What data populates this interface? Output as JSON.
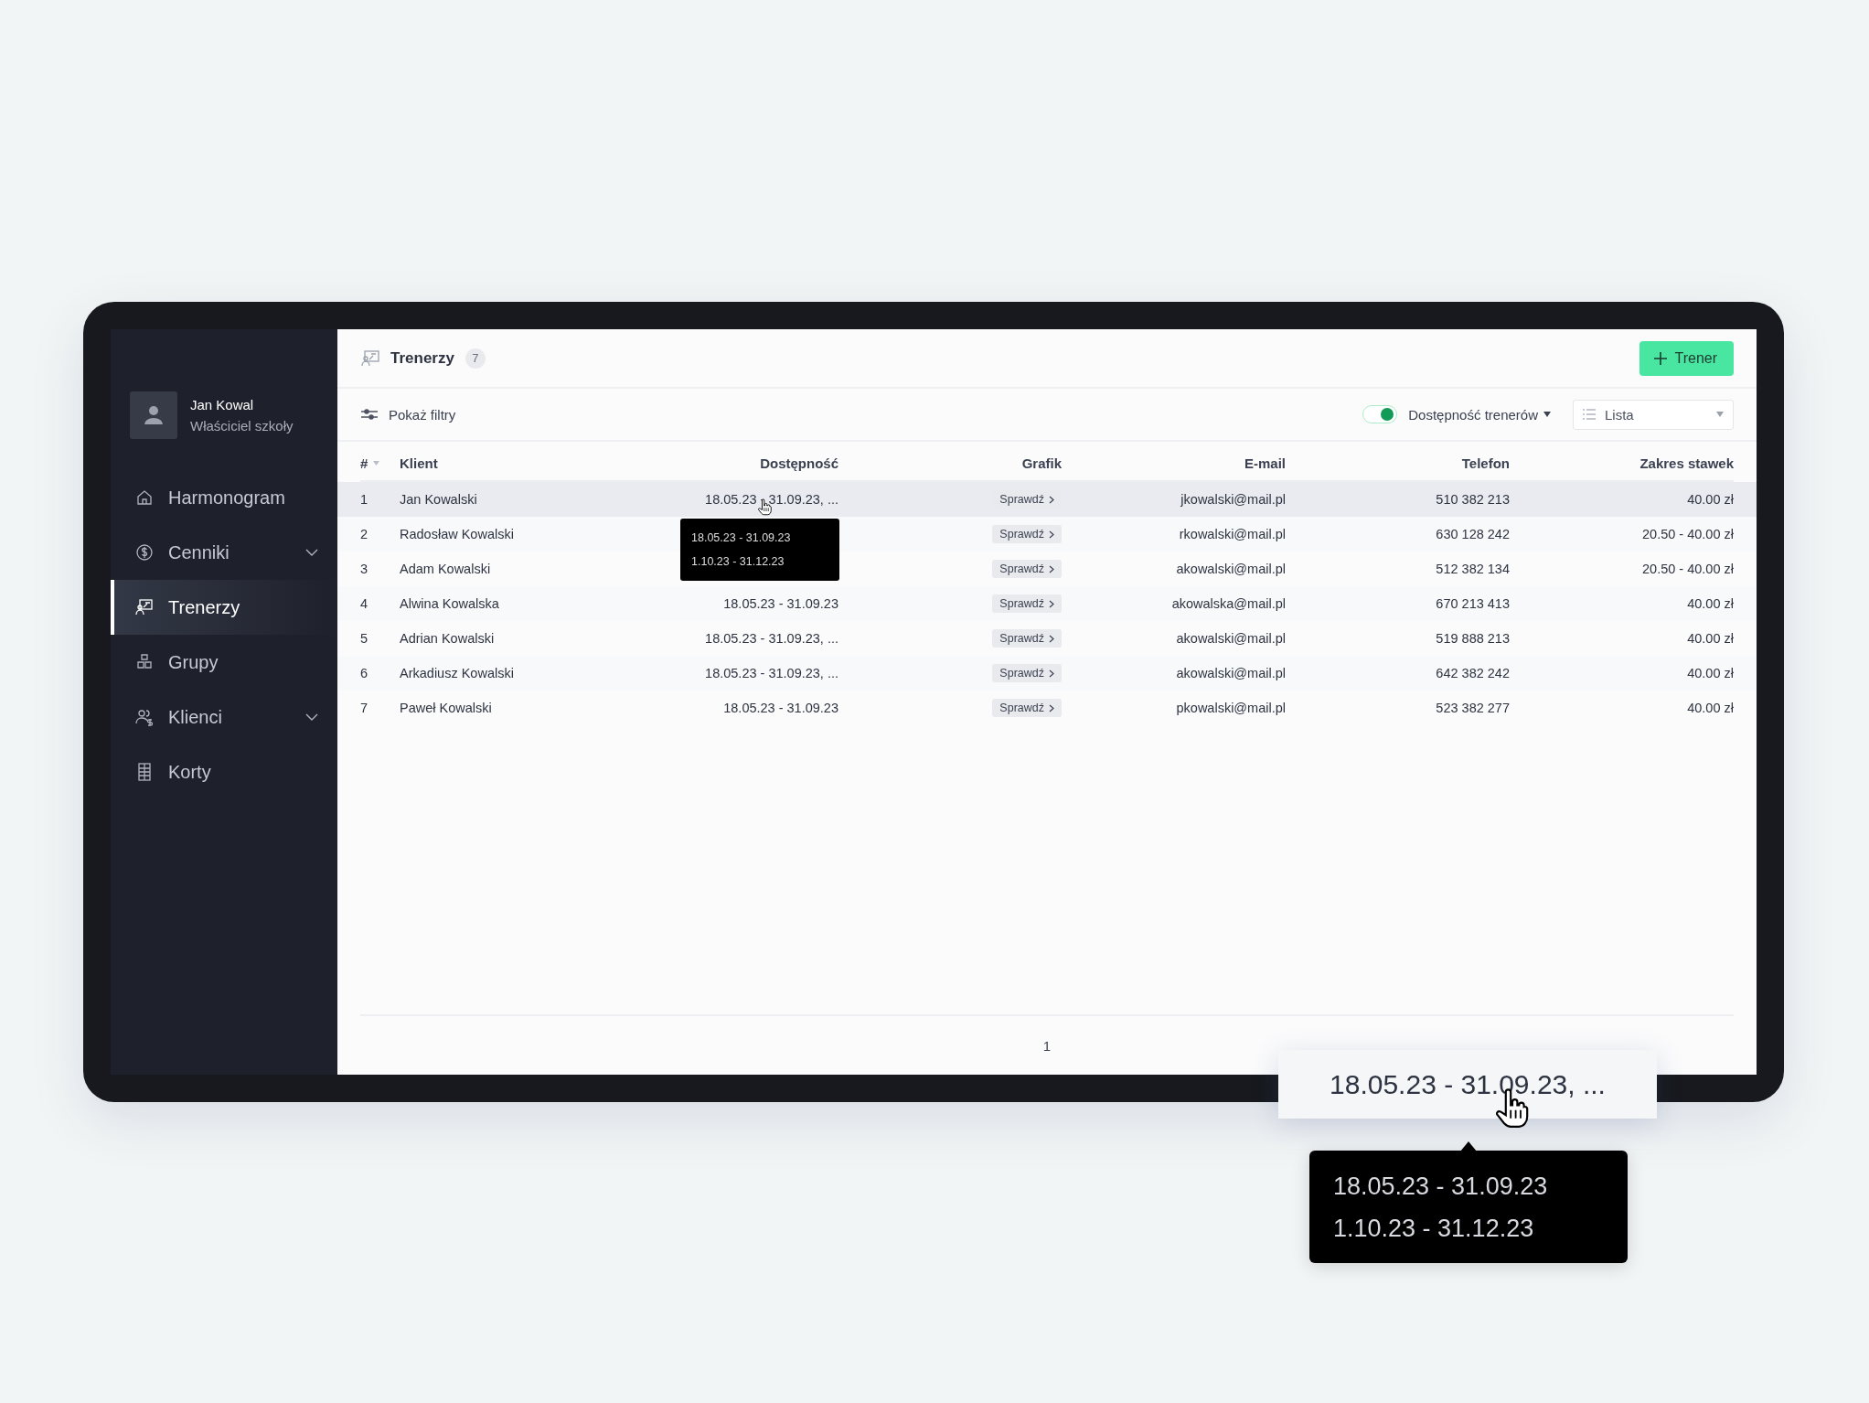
{
  "sidebar": {
    "user": {
      "name": "Jan Kowal",
      "role": "Właściciel szkoły"
    },
    "items": [
      {
        "label": "Harmonogram",
        "selected": false,
        "expandable": false
      },
      {
        "label": "Cenniki",
        "selected": false,
        "expandable": true
      },
      {
        "label": "Trenerzy",
        "selected": true,
        "expandable": false
      },
      {
        "label": "Grupy",
        "selected": false,
        "expandable": false
      },
      {
        "label": "Klienci",
        "selected": false,
        "expandable": true
      },
      {
        "label": "Korty",
        "selected": false,
        "expandable": false
      }
    ]
  },
  "header": {
    "title": "Trenerzy",
    "count": "7",
    "add_button": "Trener"
  },
  "toolbar": {
    "filters_label": "Pokaż filtry",
    "availability_toggle": {
      "label": "Dostępność trenerów",
      "on": true
    },
    "view_select": {
      "value": "Lista"
    }
  },
  "table": {
    "columns": [
      "#",
      "Klient",
      "Dostępność",
      "Grafik",
      "E-mail",
      "Telefon",
      "Zakres stawek"
    ],
    "rows": [
      {
        "number": "1",
        "client": "Jan Kowalski",
        "availability": "18.05.23 - 31.09.23, ...",
        "schedule": "Sprawdź",
        "email": "jkowalski@mail.pl",
        "phone": "510 382 213",
        "rates": "40.00 zł",
        "hovered": true
      },
      {
        "number": "2",
        "client": "Radosław Kowalski",
        "schedule": "Sprawdź",
        "email": "rkowalski@mail.pl",
        "phone": "630 128 242",
        "rates": "20.50 - 40.00 zł",
        "hovered": false
      },
      {
        "number": "3",
        "client": "Adam Kowalski",
        "schedule": "Sprawdź",
        "email": "akowalski@mail.pl",
        "phone": "512 382 134",
        "rates": "20.50 - 40.00 zł",
        "hovered": false
      },
      {
        "number": "4",
        "client": "Alwina Kowalska",
        "availability": "18.05.23 - 31.09.23",
        "schedule": "Sprawdź",
        "email": "akowalska@mail.pl",
        "phone": "670 213 413",
        "rates": "40.00 zł",
        "hovered": false
      },
      {
        "number": "5",
        "client": "Adrian Kowalski",
        "availability": "18.05.23 - 31.09.23, ...",
        "schedule": "Sprawdź",
        "email": "akowalski@mail.pl",
        "phone": "519 888 213",
        "rates": "40.00 zł",
        "hovered": false
      },
      {
        "number": "6",
        "client": "Arkadiusz Kowalski",
        "availability": "18.05.23 - 31.09.23, ...",
        "schedule": "Sprawdź",
        "email": "akowalski@mail.pl",
        "phone": "642 382 242",
        "rates": "40.00 zł",
        "hovered": false
      },
      {
        "number": "7",
        "client": "Paweł Kowalski",
        "availability": "18.05.23 - 31.09.23",
        "schedule": "Sprawdź",
        "email": "pkowalski@mail.pl",
        "phone": "523 382 277",
        "rates": "40.00 zł",
        "hovered": false
      }
    ],
    "tooltip": {
      "lines": [
        "18.05.23 - 31.09.23",
        "1.10.23 - 31.12.23"
      ]
    }
  },
  "pagination": {
    "pages": [
      "1"
    ]
  },
  "zoom_callout": {
    "text": "18.05.23 - 31.09.23, ...",
    "tooltip_lines": [
      "18.05.23 - 31.09.23",
      "1.10.23 - 31.12.23"
    ]
  }
}
